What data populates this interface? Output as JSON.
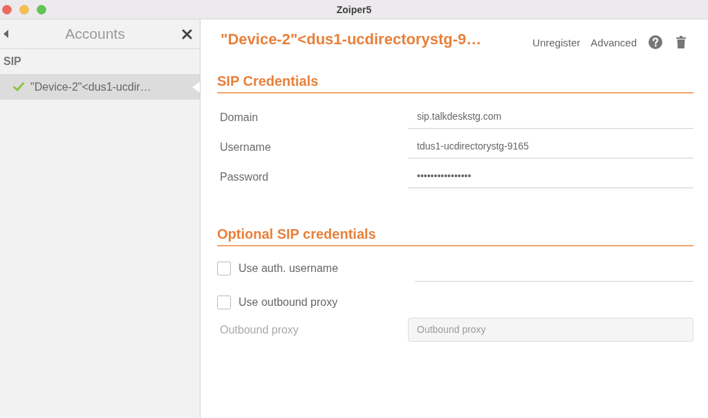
{
  "window": {
    "title": "Zoiper5"
  },
  "sidebar": {
    "title": "Accounts",
    "groups": [
      {
        "label": "SIP",
        "accounts": [
          {
            "name": "\"Device-2\"<dus1-ucdir…",
            "selected": true,
            "registered": true
          }
        ]
      }
    ]
  },
  "account": {
    "title": "\"Device-2\"<dus1-ucdirectorystg-9…",
    "actions": [
      "Unregister",
      "Advanced"
    ]
  },
  "sections": [
    {
      "title": "SIP Credentials",
      "rows": [
        {
          "kind": "text",
          "label": "Domain",
          "value": "sip.talkdeskstg.com"
        },
        {
          "kind": "text",
          "label": "Username",
          "value": "tdus1-ucdirectorystg-9165"
        },
        {
          "kind": "text",
          "label": "Password",
          "value": "••••••••••••••••"
        }
      ]
    },
    {
      "title": "Optional SIP credentials",
      "rows": [
        {
          "kind": "checkbox_field",
          "label": "Use auth. username",
          "checked": false
        },
        {
          "kind": "checkbox",
          "label": "Use outbound proxy",
          "checked": false
        },
        {
          "kind": "boxed",
          "label": "Outbound proxy",
          "placeholder": "Outbound proxy",
          "disabled": true
        }
      ]
    }
  ]
}
